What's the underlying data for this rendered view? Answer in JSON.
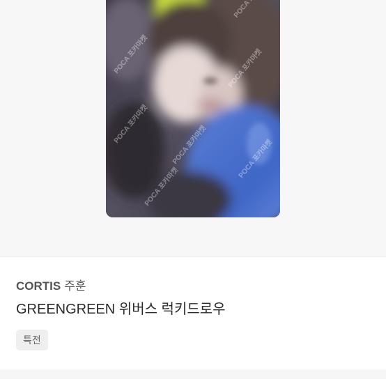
{
  "product": {
    "group": "CORTIS",
    "member": "주훈",
    "name": "GREENGREEN 위버스 럭키드로우",
    "tag": "특전"
  },
  "photo": {
    "watermark": "POCA 포카마켓"
  }
}
